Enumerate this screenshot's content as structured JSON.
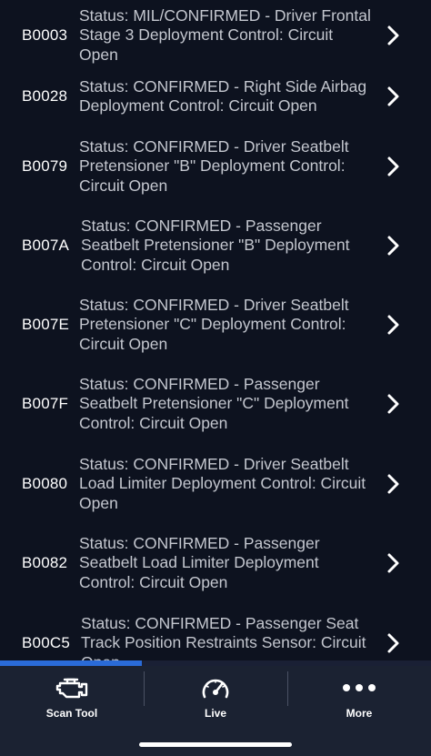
{
  "dtc_list": [
    {
      "code": "B0003",
      "description": "Status: MIL/CONFIRMED - Driver Frontal Stage 3 Deployment Control: Circuit Open"
    },
    {
      "code": "B0028",
      "description": "Status: CONFIRMED - Right Side Airbag Deployment Control: Circuit Open"
    },
    {
      "code": "B0079",
      "description": "Status: CONFIRMED - Driver Seatbelt Pretensioner \"B\" Deployment Control: Circuit Open"
    },
    {
      "code": "B007A",
      "description": "Status: CONFIRMED - Passenger Seatbelt Pretensioner \"B\" Deployment Control: Circuit Open"
    },
    {
      "code": "B007E",
      "description": "Status: CONFIRMED - Driver Seatbelt Pretensioner \"C\" Deployment Control: Circuit Open"
    },
    {
      "code": "B007F",
      "description": "Status: CONFIRMED - Passenger Seatbelt Pretensioner \"C\" Deployment Control: Circuit Open"
    },
    {
      "code": "B0080",
      "description": "Status: CONFIRMED - Driver Seatbelt Load Limiter Deployment Control: Circuit Open"
    },
    {
      "code": "B0082",
      "description": "Status: CONFIRMED - Passenger Seatbelt Load Limiter Deployment Control: Circuit Open"
    },
    {
      "code": "B00C5",
      "description": "Status: CONFIRMED - Passenger Seat Track Position Restraints Sensor: Circuit Open"
    }
  ],
  "scroll_progress_percent": 33,
  "tabbar": {
    "tabs": [
      {
        "label": "Scan Tool",
        "icon": "engine-icon"
      },
      {
        "label": "Live",
        "icon": "gauge-icon"
      },
      {
        "label": "More",
        "icon": "more-dots-icon"
      }
    ]
  },
  "colors": {
    "background": "#0d121f",
    "tabbar": "#1b2232",
    "accent": "#2a6bd8",
    "description_text": "#c4c7cf"
  }
}
